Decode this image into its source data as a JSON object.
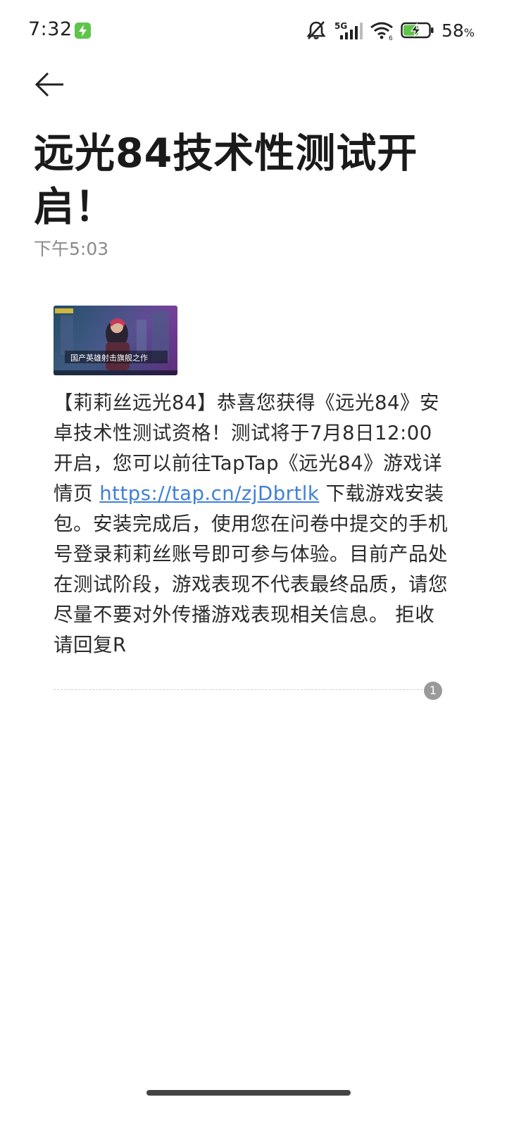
{
  "status_bar": {
    "time": "7:32",
    "network": "5G",
    "battery_percent": "58",
    "battery_unit": "%",
    "battery_level": 0.58,
    "charging": true,
    "accent_color": "#5ec44a"
  },
  "header": {
    "back_icon": "arrow-left-icon",
    "title": "远光84技术性测试开启！",
    "time": "下午5:03"
  },
  "message": {
    "text_before_link": "【莉莉丝远光84】恭喜您获得《远光84》安卓技术性测试资格！测试将于7月8日12:00开启，您可以前往TapTap《远光84》游戏详情页 ",
    "link": "https://tap.cn/zjDbrtlk",
    "text_after_link": " 下载游戏安装包。安装完成后，使用您在问卷中提交的手机号登录莉莉丝账号即可参与体验。目前产品处在测试阶段，游戏表现不代表最终品质，请您尽量不要对外传播游戏表现相关信息。 拒收请回复R",
    "link_color": "#3f7fd9",
    "image_caption": "国产英雄射击旗舰之作",
    "count": "1"
  }
}
